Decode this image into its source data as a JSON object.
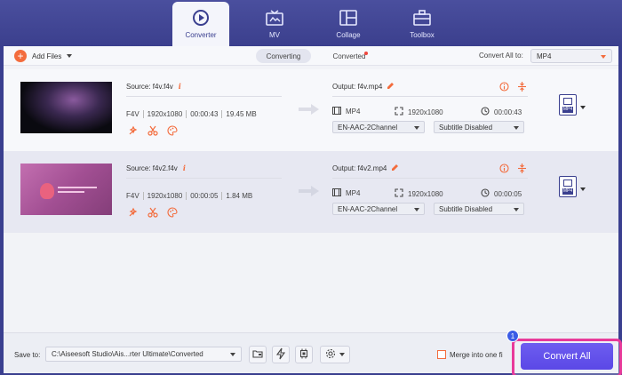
{
  "nav": {
    "tabs": [
      {
        "label": "Converter",
        "icon": "converter-icon",
        "active": true
      },
      {
        "label": "MV",
        "icon": "mv-icon"
      },
      {
        "label": "Collage",
        "icon": "collage-icon"
      },
      {
        "label": "Toolbox",
        "icon": "toolbox-icon"
      }
    ]
  },
  "toolbar": {
    "add_files": "Add Files",
    "converting": "Converting",
    "converted": "Converted",
    "convert_all_to": "Convert All to:",
    "format": "MP4"
  },
  "files": [
    {
      "source": "Source: f4v.f4v",
      "format": "F4V",
      "resolution": "1920x1080",
      "duration": "00:00:43",
      "size": "19.45 MB",
      "output": "Output: f4v.mp4",
      "out_format": "MP4",
      "out_resolution": "1920x1080",
      "out_duration": "00:00:43",
      "audio": "EN-AAC-2Channel",
      "subtitle": "Subtitle Disabled",
      "badge": "MP4"
    },
    {
      "source": "Source: f4v2.f4v",
      "format": "F4V",
      "resolution": "1920x1080",
      "duration": "00:00:05",
      "size": "1.84 MB",
      "output": "Output: f4v2.mp4",
      "out_format": "MP4",
      "out_resolution": "1920x1080",
      "out_duration": "00:00:05",
      "audio": "EN-AAC-2Channel",
      "subtitle": "Subtitle Disabled",
      "badge": "MP4"
    }
  ],
  "bottom": {
    "save_to": "Save to:",
    "path": "C:\\Aiseesoft Studio\\Ais...rter Ultimate\\Converted",
    "merge": "Merge into one fi",
    "convert_all": "Convert All",
    "step": "1"
  },
  "colors": {
    "accent": "#f36c3d",
    "nav_bg": "#3a3f8f",
    "convert_btn": "#5b48e6",
    "highlight": "#e83a9a"
  }
}
